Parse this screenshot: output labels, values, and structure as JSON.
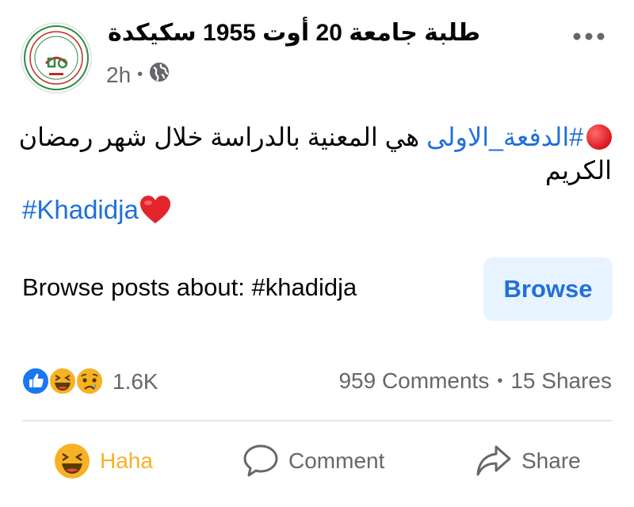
{
  "page": {
    "title": "طلبة جامعة 20 أوت 1955 سكيكدة",
    "time": "2h",
    "dot": "•"
  },
  "post": {
    "hashtag_batch": "#الدفعة_الاولى",
    "text_after_hashtag": "هي المعنية بالدراسة خلال شهر رمضان الكريم",
    "hashtag_name": "#Khadidja"
  },
  "browse": {
    "label": "Browse posts about: #khadidja",
    "button": "Browse"
  },
  "engagement": {
    "reaction_count": "1.6K",
    "comments": "959 Comments",
    "separator": "•",
    "shares": "15 Shares"
  },
  "actions": {
    "haha": "Haha",
    "comment": "Comment",
    "share": "Share"
  },
  "colors": {
    "accent": "#216fdb",
    "haha": "#f7b125",
    "muted": "#65676b"
  },
  "icons": {
    "avatar": "university-logo",
    "privacy": "globe-icon",
    "more": "more-options-icon",
    "heart": "red-heart-emoji",
    "reactions": [
      "like-reaction-icon",
      "haha-reaction-icon",
      "sad-reaction-icon"
    ]
  }
}
